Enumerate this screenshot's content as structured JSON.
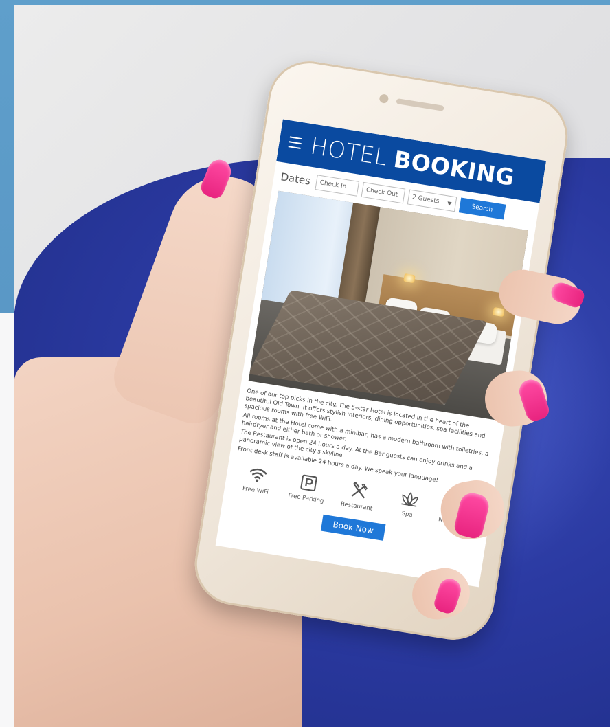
{
  "app": {
    "title_light": "HOTEL",
    "title_bold": "BOOKING",
    "menu_icon": "hamburger-menu-icon",
    "header_color": "#0a4aa0",
    "accent_color": "#1f78d8"
  },
  "search": {
    "dates_label": "Dates",
    "check_in_placeholder": "Check In",
    "check_out_placeholder": "Check Out",
    "guests_value": "2 Guests",
    "search_label": "Search"
  },
  "description": {
    "paragraphs": [
      "One of our top picks in the city. The 5-star Hotel is located in the heart of the beautiful Old Town. It offers stylish interiors, dining opportunities, spa facilities and spacious rooms with free WiFi.",
      "All rooms at the Hotel come with a minibar, has a modern bathroom with toiletries, a hairdryer and either bath or shower.",
      "The Restaurant is open 24 hours a day. At the Bar guests can enjoy drinks and a panoramic view of the city's skyline.",
      "Front desk staff is available 24 hours a day. We speak your language!"
    ]
  },
  "amenities": [
    {
      "label": "Free WiFi",
      "icon": "wifi-icon"
    },
    {
      "label": "Free Parking",
      "icon": "parking-icon"
    },
    {
      "label": "Restaurant",
      "icon": "fork-knife-icon"
    },
    {
      "label": "Spa",
      "icon": "lotus-icon"
    },
    {
      "label": "Non Smoking",
      "icon": "no-smoking-icon"
    }
  ],
  "booking": {
    "book_label": "Book Now"
  }
}
